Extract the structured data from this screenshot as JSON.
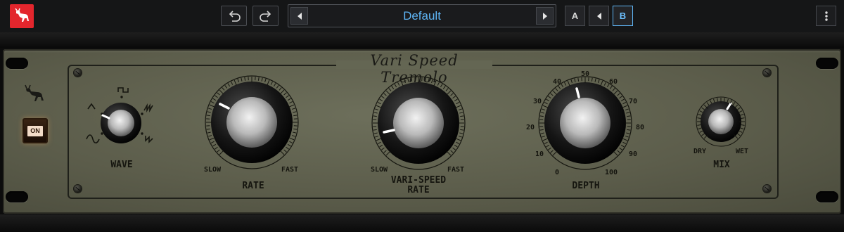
{
  "toolbar": {
    "logo_icon": "antelope-icon",
    "undo_icon": "undo-icon",
    "redo_icon": "redo-icon",
    "preset_name": "Default",
    "compare_a": "A",
    "compare_b": "B",
    "active_compare": "B",
    "menu_icon": "kebab-menu-icon"
  },
  "plugin": {
    "title": "Vari Speed Tremolo",
    "power_label": "ON",
    "wave": {
      "label": "WAVE",
      "shapes": [
        "square",
        "triangle",
        "saw-up",
        "sine",
        "saw-down"
      ]
    },
    "rate": {
      "label": "RATE",
      "min_label": "SLOW",
      "max_label": "FAST"
    },
    "vari_speed_rate": {
      "label_line1": "VARI-SPEED",
      "label_line2": "RATE",
      "min_label": "SLOW",
      "max_label": "FAST"
    },
    "depth": {
      "label": "DEPTH",
      "scale": [
        "0",
        "10",
        "20",
        "30",
        "40",
        "50",
        "60",
        "70",
        "80",
        "90",
        "100"
      ]
    },
    "mix": {
      "label": "MIX",
      "min_label": "DRY",
      "max_label": "WET"
    }
  },
  "colors": {
    "accent": "#5eb4f4",
    "logo": "#e3262d",
    "faceplate": "#606250"
  }
}
